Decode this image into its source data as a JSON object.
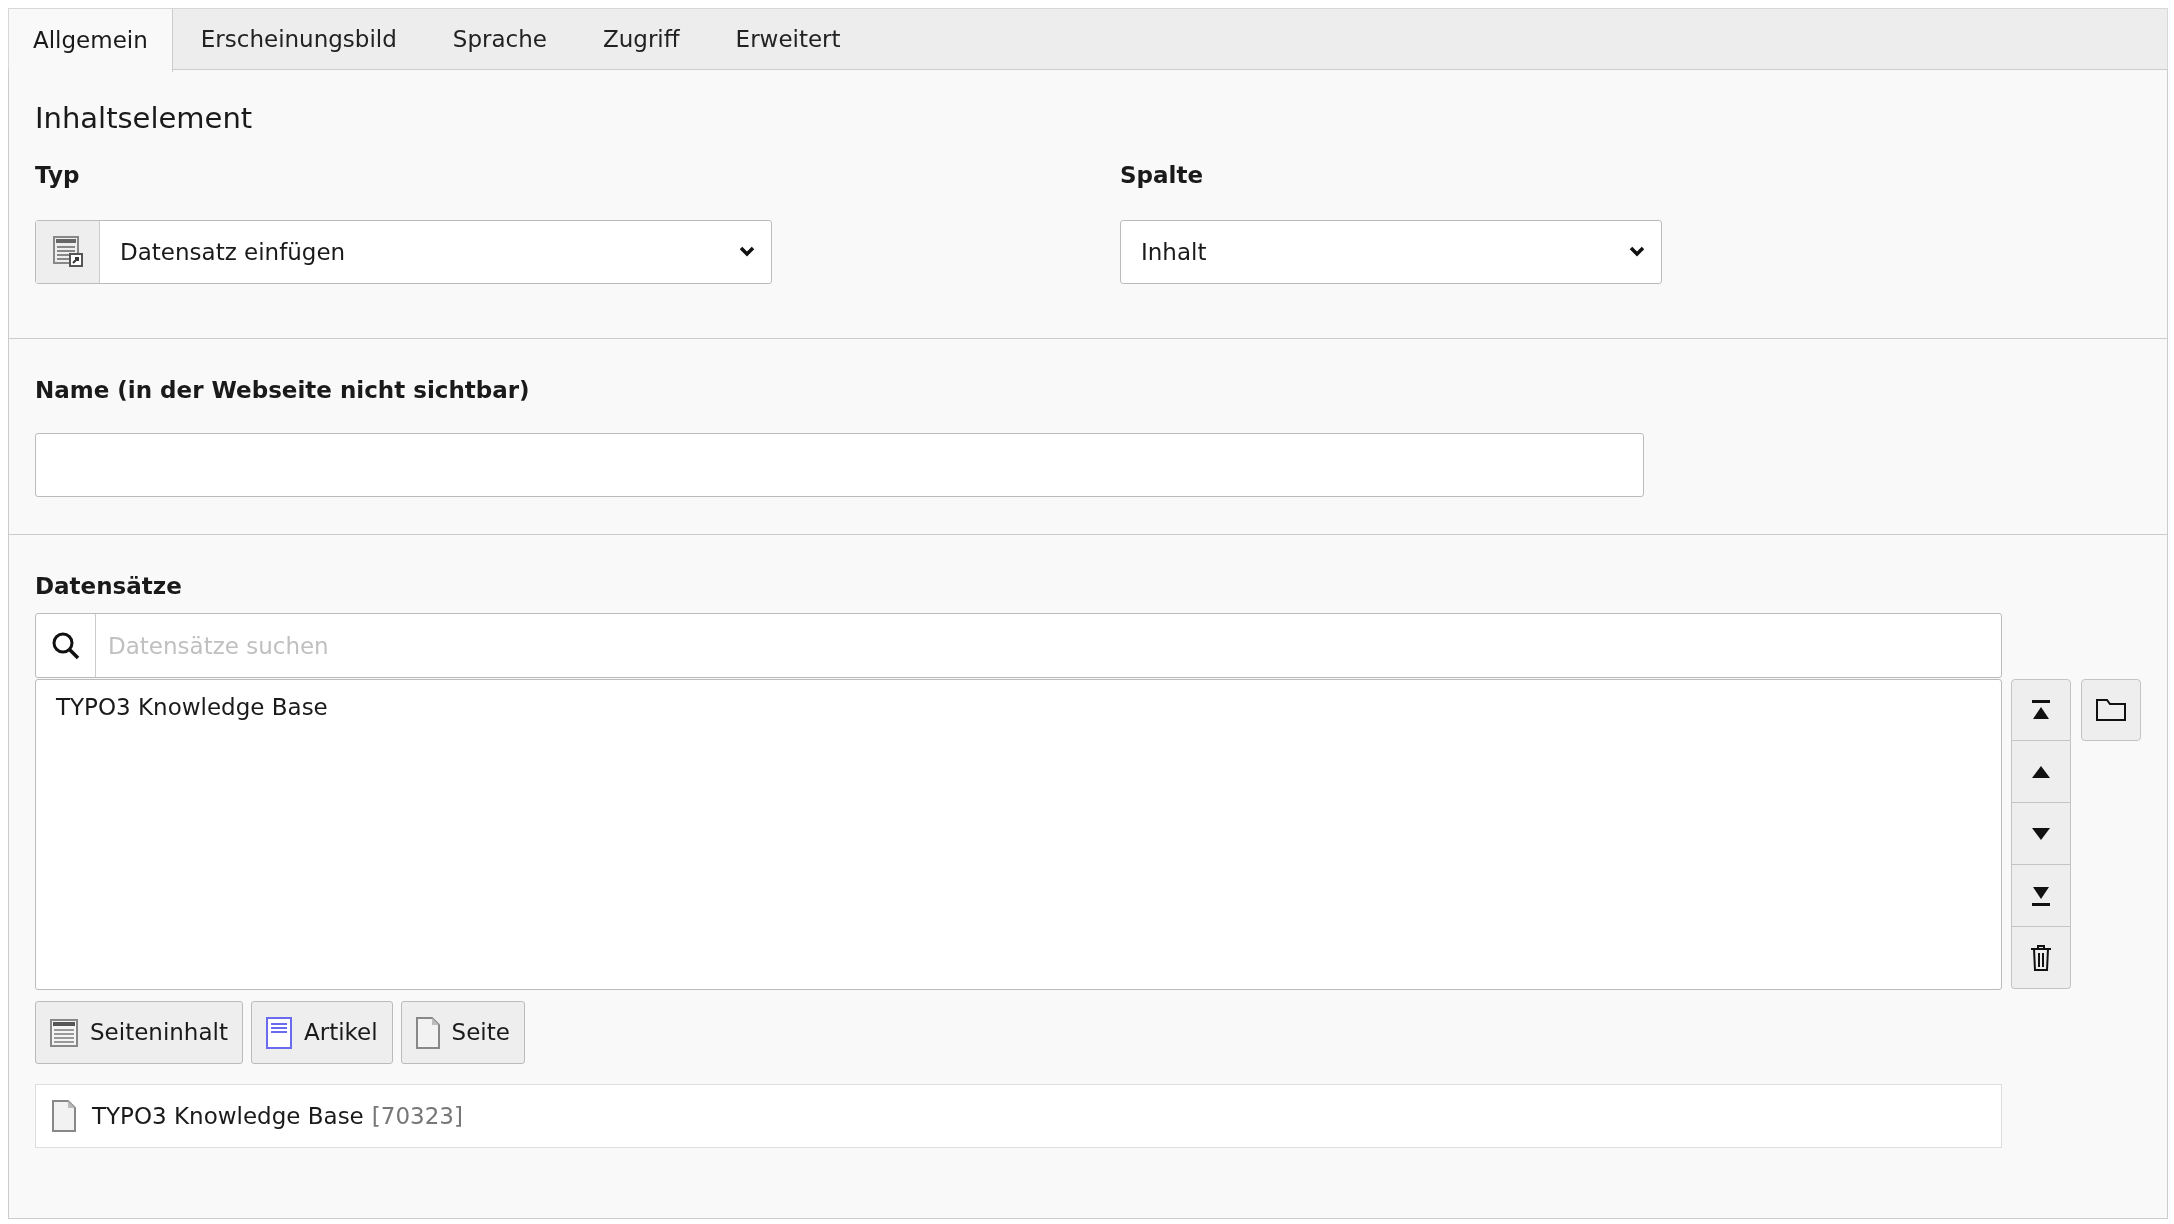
{
  "tabs": [
    {
      "label": "Allgemein",
      "selected": true
    },
    {
      "label": "Erscheinungsbild",
      "selected": false
    },
    {
      "label": "Sprache",
      "selected": false
    },
    {
      "label": "Zugriff",
      "selected": false
    },
    {
      "label": "Erweitert",
      "selected": false
    }
  ],
  "section_title": "Inhaltselement",
  "type_field": {
    "label": "Typ",
    "value": "Datensatz einfügen"
  },
  "column_field": {
    "label": "Spalte",
    "value": "Inhalt"
  },
  "name_field": {
    "label": "Name (in der Webseite nicht sichtbar)"
  },
  "records": {
    "label": "Datensätze",
    "search": {
      "placeholder": "Datensätze suchen"
    },
    "list_items": [
      "TYPO3 Knowledge Base"
    ],
    "add_buttons": [
      {
        "kind": "content",
        "label": "Seiteninhalt"
      },
      {
        "kind": "article",
        "label": "Artikel"
      },
      {
        "kind": "page",
        "label": "Seite"
      }
    ],
    "selected_records": [
      {
        "title": "TYPO3 Knowledge Base",
        "uid": "[70323]"
      }
    ]
  }
}
